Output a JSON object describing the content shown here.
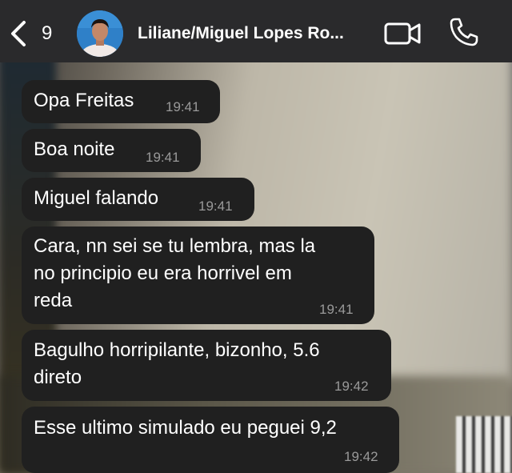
{
  "header": {
    "back_count": "9",
    "title": "Liliane/Miguel Lopes Ro...",
    "video_icon": "video-camera-icon",
    "call_icon": "phone-icon"
  },
  "messages": [
    {
      "text": "Opa Freitas",
      "time": "19:41"
    },
    {
      "text": "Boa noite",
      "time": "19:41"
    },
    {
      "text": "Miguel falando",
      "time": "19:41"
    },
    {
      "lines": [
        "Cara, nn sei se tu lembra, mas la",
        "no principio eu era horrivel em",
        "reda"
      ],
      "time": "19:41"
    },
    {
      "lines": [
        "Bagulho horripilante, bizonho, 5.6",
        "direto"
      ],
      "time": "19:42"
    },
    {
      "text": "Esse ultimo simulado eu peguei 9,2",
      "time": "19:42"
    }
  ],
  "colors": {
    "header_bg": "#2a2a2c",
    "bubble_bg": "#202020",
    "time_text": "#9a9a9a"
  }
}
